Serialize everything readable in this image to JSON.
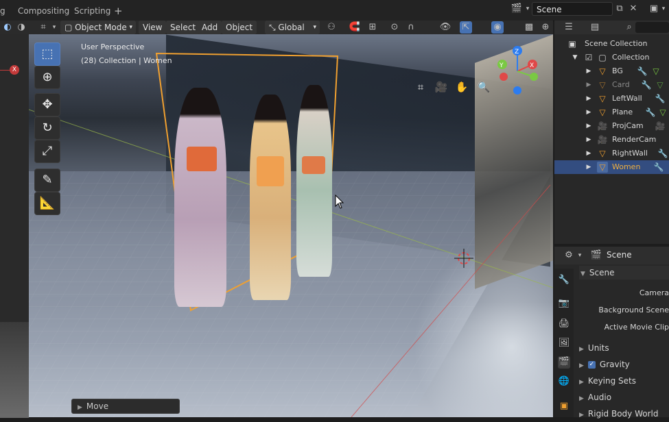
{
  "workspace_tabs": [
    "g",
    "Compositing",
    "Scripting",
    "+"
  ],
  "scene_name": "Scene",
  "viewport_header": {
    "mode": "Object Mode",
    "menus": [
      "View",
      "Select",
      "Add",
      "Object"
    ],
    "orientation": "Global"
  },
  "viewport": {
    "perspective": "User Perspective",
    "collection_info": "(28) Collection | Women"
  },
  "operator_panel": {
    "label": "Move"
  },
  "outliner": {
    "root": "Scene Collection",
    "collection": "Collection",
    "items": [
      {
        "label": "BG",
        "icon": "mesh-icon",
        "dim": false,
        "selected": false
      },
      {
        "label": "Card",
        "icon": "mesh-icon",
        "dim": true,
        "selected": false
      },
      {
        "label": "LeftWall",
        "icon": "mesh-icon",
        "dim": false,
        "selected": false
      },
      {
        "label": "Plane",
        "icon": "mesh-icon",
        "dim": false,
        "selected": false
      },
      {
        "label": "ProjCam",
        "icon": "camera-icon",
        "dim": false,
        "selected": false
      },
      {
        "label": "RenderCam",
        "icon": "camera-icon",
        "dim": false,
        "selected": false
      },
      {
        "label": "RightWall",
        "icon": "mesh-icon",
        "dim": false,
        "selected": false
      },
      {
        "label": "Women",
        "icon": "mesh-icon",
        "dim": false,
        "selected": true
      }
    ]
  },
  "properties": {
    "context": "Scene",
    "panel_title": "Scene",
    "fields": [
      "Camera",
      "Background Scene",
      "Active Movie Clip"
    ],
    "subpanels": [
      {
        "label": "Units",
        "checkbox": false
      },
      {
        "label": "Gravity",
        "checkbox": true
      },
      {
        "label": "Keying Sets",
        "checkbox": false
      },
      {
        "label": "Audio",
        "checkbox": false
      },
      {
        "label": "Rigid Body World",
        "checkbox": false
      }
    ]
  },
  "colors": {
    "accent": "#4772b3",
    "selection": "#334d80",
    "object_outline": "#f0a030",
    "axis_x": "#e04848",
    "axis_y": "#7ac943",
    "axis_z": "#2c7cf0"
  }
}
